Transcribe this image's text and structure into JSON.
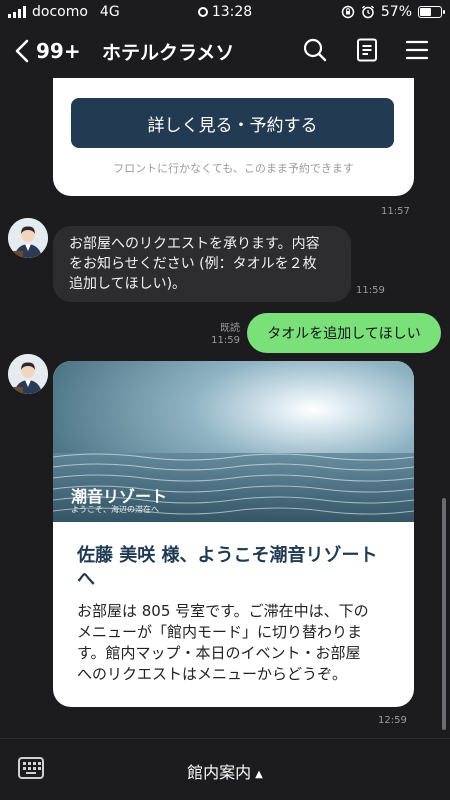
{
  "status_bar": {
    "carrier": "docomo",
    "network": "4G",
    "time": "13:28",
    "battery": "57%",
    "battery_level": 0.57
  },
  "header": {
    "back_count": "99+",
    "title": "ホテルクラメソ",
    "icons": [
      "search-icon",
      "note-icon",
      "hamburger-icon"
    ]
  },
  "messages": {
    "card_top": {
      "button_label": "詳しく見る・予約する",
      "note": "フロントに行かなくても、このまま予約できます",
      "time": "11:57"
    },
    "incoming_1": {
      "line1": "お部屋へのリクエストを承ります。内容",
      "line2": "をお知らせください (例：タオルを２枚",
      "line3": "追加してほしい)。",
      "time": "11:59"
    },
    "outgoing_1": {
      "read": "既読",
      "time": "11:59",
      "text": "タオルを追加してほしい"
    },
    "welcome_card": {
      "hero_title": "潮音リゾート",
      "hero_subtitle": "ようこそ、海辺の滞在へ",
      "title_line1": "佐藤 美咲 様、ようこそ潮音リゾート",
      "title_line2": "へ",
      "body_line1": "お部屋は 805 号室です。ご滞在中は、下の",
      "body_line2": "メニューが「館内モード」に切り替わりま",
      "body_line3": "す。館内マップ・本日のイベント・お部屋",
      "body_line4": "へのリクエストはメニューからどうぞ。",
      "time": "12:59"
    }
  },
  "bottom_bar": {
    "menu_label": "館内案内",
    "menu_arrow": "▲"
  },
  "colors": {
    "background": "#1c1c1e",
    "incoming_bubble": "#2d2d30",
    "outgoing_bubble": "#79e07a",
    "button": "#223a52",
    "card_title": "#1f3a52"
  }
}
